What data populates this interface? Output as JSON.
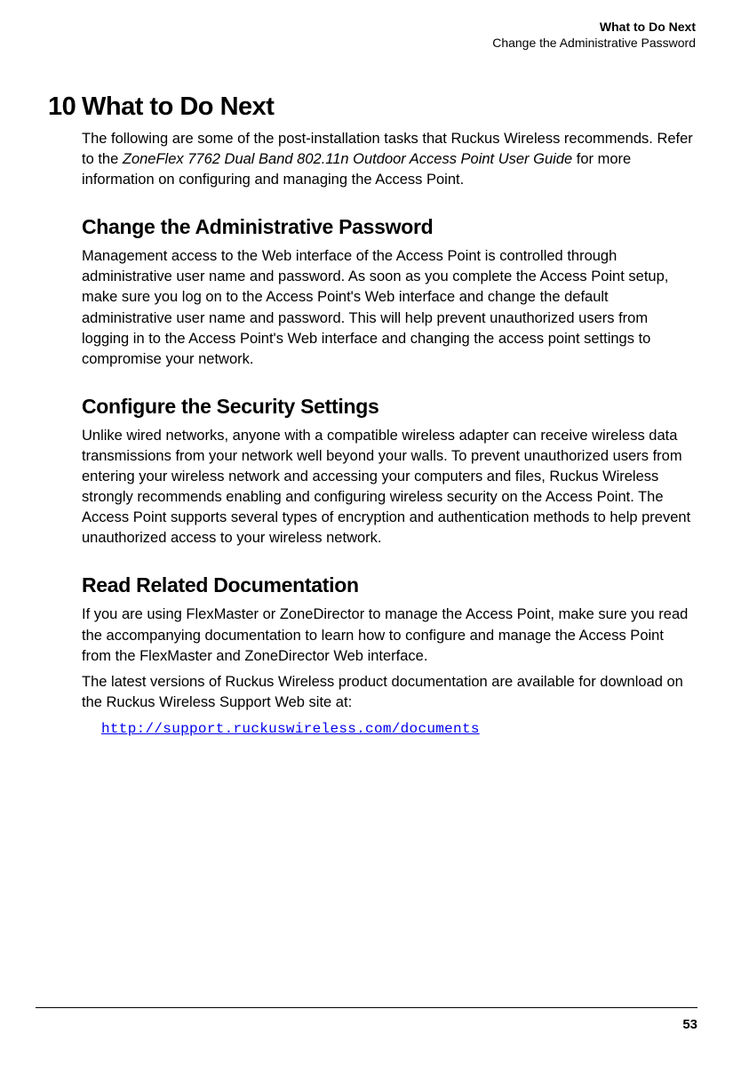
{
  "header": {
    "title": "What to Do Next",
    "subtitle": "Change the Administrative Password"
  },
  "chapter": {
    "number": "10",
    "title": "What to Do Next",
    "intro_pre": "The following are some of the post-installation tasks that Ruckus Wireless recommends. Refer to the ",
    "intro_italic": "ZoneFlex 7762 Dual Band 802.11n Outdoor Access Point User Guide",
    "intro_post": " for more information on configuring and managing the Access Point."
  },
  "sections": {
    "s1": {
      "title": "Change the Administrative Password",
      "body": "Management access to the Web interface of the Access Point is controlled through administrative user name and password. As soon as you complete the Access Point setup, make sure you log on to the Access Point's Web interface and change the default administrative user name and password. This will help prevent unauthorized users from logging in to the Access Point's Web interface and changing the access point settings to compromise your network."
    },
    "s2": {
      "title": "Configure the Security Settings",
      "body": "Unlike wired networks, anyone with a compatible wireless adapter can receive wireless data transmissions from your network well beyond your walls. To prevent unauthorized users from entering your wireless network and accessing your computers and files, Ruckus Wireless strongly recommends enabling and configuring wireless security on the Access Point. The Access Point supports several types of encryption and authentication methods to help prevent unauthorized access to your wireless network."
    },
    "s3": {
      "title": "Read Related Documentation",
      "p1": "If you are using FlexMaster or ZoneDirector to manage the Access Point, make sure you read the accompanying documentation to learn how to configure and manage the Access Point from the FlexMaster and ZoneDirector Web interface.",
      "p2": "The latest versions of Ruckus Wireless product documentation are available for download on the Ruckus Wireless Support Web site at:",
      "link": "http://support.ruckuswireless.com/documents"
    }
  },
  "footer": {
    "page": "53"
  }
}
